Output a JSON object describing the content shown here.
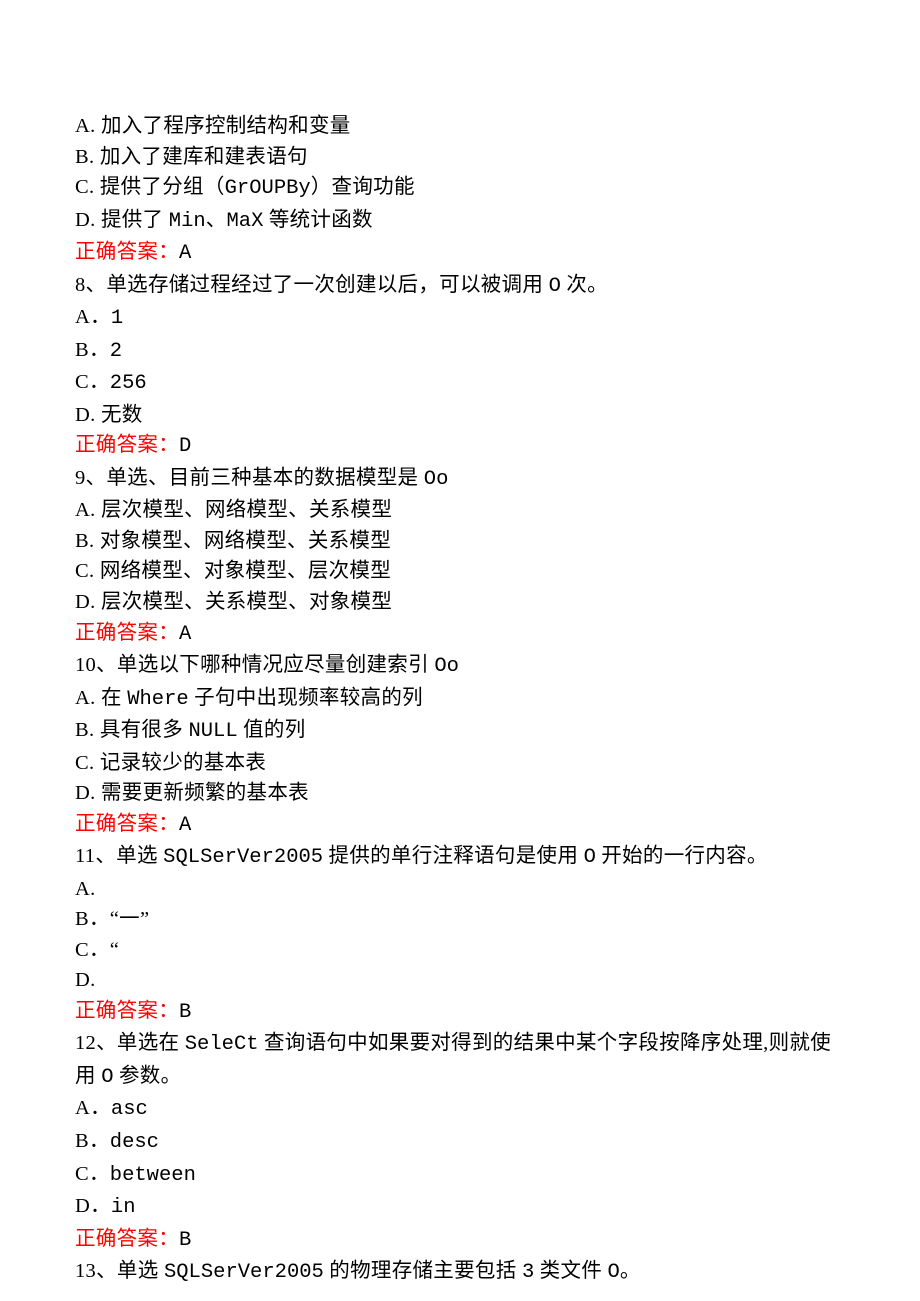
{
  "q7": {
    "optA": "A. 加入了程序控制结构和变量",
    "optB": "B. 加入了建库和建表语句",
    "optC_prefix": "C. 提供了分组（",
    "optC_en": "GrOUPBy",
    "optC_suffix": "）查询功能",
    "optD_prefix": "D. 提供了 ",
    "optD_en1": "Min",
    "optD_mid": "、",
    "optD_en2": "MaX",
    "optD_suffix": " 等统计函数",
    "answer_label": "正确答案：",
    "answer_value": "A"
  },
  "q8": {
    "stem_prefix": "8、单选存储过程经过了一次创建以后，可以被调用 ",
    "stem_en": "O",
    "stem_suffix": " 次。",
    "optA_label": "A．",
    "optA_val": "1",
    "optB_label": "B．",
    "optB_val": "2",
    "optC_label": "C．",
    "optC_val": "256",
    "optD": "D. 无数",
    "answer_label": "正确答案：",
    "answer_value": "D"
  },
  "q9": {
    "stem_prefix": "9、单选、目前三种基本的数据模型是 ",
    "stem_en": "Oo",
    "optA": "A. 层次模型、网络模型、关系模型",
    "optB": "B. 对象模型、网络模型、关系模型",
    "optC": "C. 网络模型、对象模型、层次模型",
    "optD": "D. 层次模型、关系模型、对象模型",
    "answer_label": "正确答案：",
    "answer_value": "A"
  },
  "q10": {
    "stem_prefix": "10、单选以下哪种情况应尽量创建索引 ",
    "stem_en": "Oo",
    "optA_prefix": "A. 在 ",
    "optA_en": "Where",
    "optA_suffix": " 子句中出现频率较高的列",
    "optB_prefix": "B. 具有很多 ",
    "optB_en": "NULL",
    "optB_suffix": " 值的列",
    "optC": "C. 记录较少的基本表",
    "optD": "D. 需要更新频繁的基本表",
    "answer_label": "正确答案：",
    "answer_value": "A"
  },
  "q11": {
    "stem_prefix": "11、单选 ",
    "stem_en1": "SQLSerVer2005",
    "stem_mid1": " 提供的单行注释语句是使用 ",
    "stem_en2": "O",
    "stem_suffix": " 开始的一行内容。",
    "optA": "A.",
    "optB": "B．“一”",
    "optC": "C．“",
    "optD": "D.",
    "answer_label": "正确答案：",
    "answer_value": "B"
  },
  "q12": {
    "stem_prefix": "12、单选在 ",
    "stem_en1": "SeleCt",
    "stem_mid1": " 查询语句中如果要对得到的结果中某个字段按降序处理,则就使用 ",
    "stem_en2": "O",
    "stem_suffix": " 参数。",
    "optA_label": "A．",
    "optA_val": "asc",
    "optB_label": "B．",
    "optB_val": "desc",
    "optC_label": "C．",
    "optC_val": "between",
    "optD_label": "D．",
    "optD_val": "in",
    "answer_label": "正确答案：",
    "answer_value": "B"
  },
  "q13": {
    "stem_prefix": "13、单选 ",
    "stem_en1": "SQLSerVer2005",
    "stem_mid1": " 的物理存储主要包括 ",
    "stem_en2": "3",
    "stem_mid2": " 类文件 ",
    "stem_en3": "O",
    "stem_suffix": "。"
  }
}
